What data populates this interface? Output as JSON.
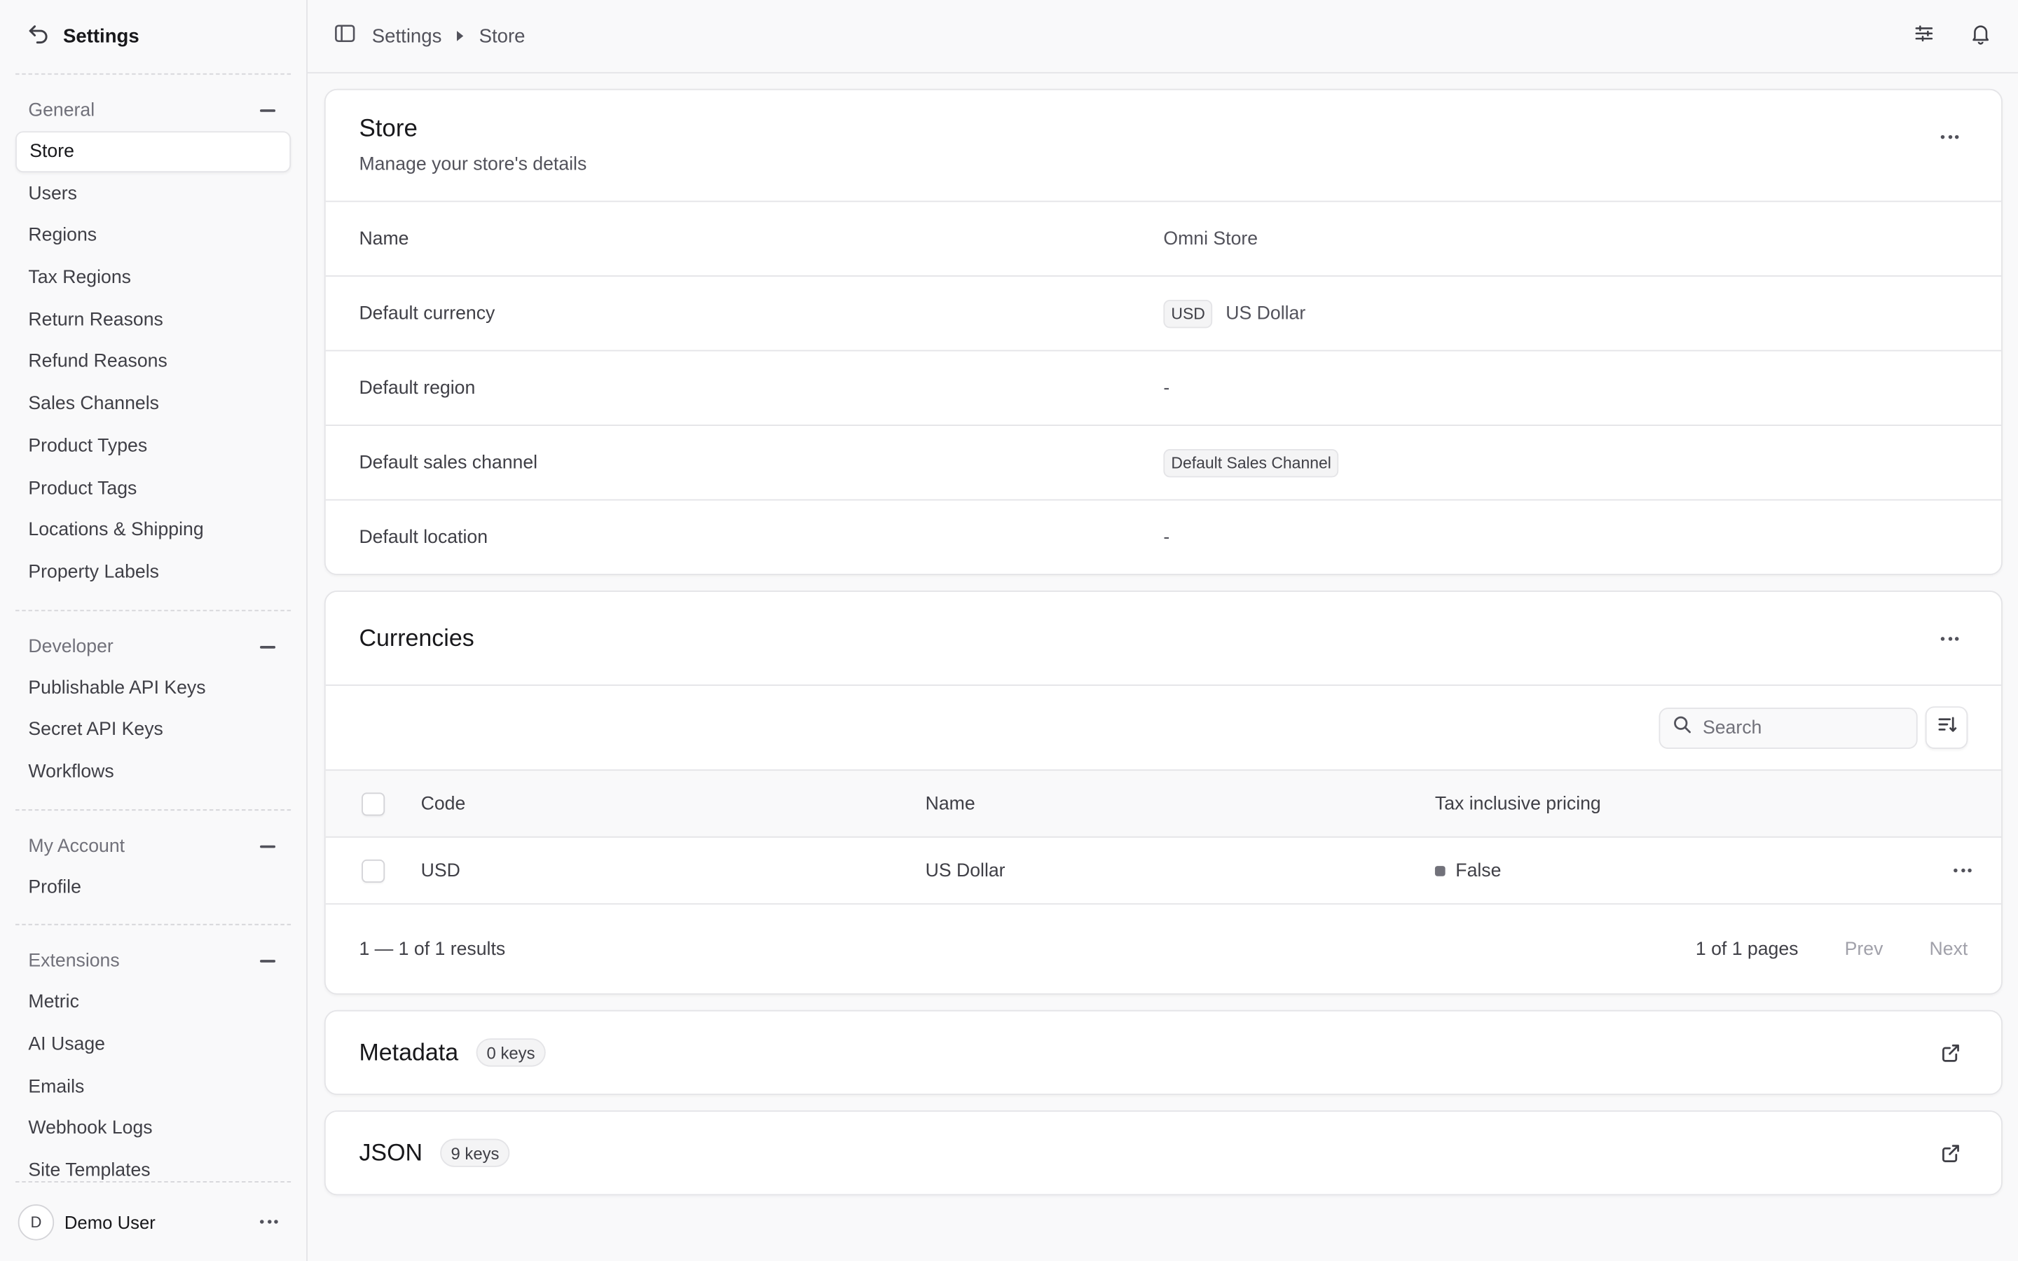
{
  "sidebar": {
    "title": "Settings",
    "sections": [
      {
        "label": "General",
        "items": [
          "Store",
          "Users",
          "Regions",
          "Tax Regions",
          "Return Reasons",
          "Refund Reasons",
          "Sales Channels",
          "Product Types",
          "Product Tags",
          "Locations & Shipping",
          "Property Labels"
        ]
      },
      {
        "label": "Developer",
        "items": [
          "Publishable API Keys",
          "Secret API Keys",
          "Workflows"
        ]
      },
      {
        "label": "My Account",
        "items": [
          "Profile"
        ]
      },
      {
        "label": "Extensions",
        "items": [
          "Metric",
          "AI Usage",
          "Emails",
          "Webhook Logs",
          "Site Templates"
        ]
      }
    ],
    "active_item": "Store",
    "user": {
      "initial": "D",
      "name": "Demo User"
    }
  },
  "breadcrumb": {
    "items": [
      "Settings",
      "Store"
    ]
  },
  "store": {
    "title": "Store",
    "subtitle": "Manage your store's details",
    "fields": {
      "name": {
        "label": "Name",
        "value": "Omni Store"
      },
      "currency": {
        "label": "Default currency",
        "code": "USD",
        "value": "US Dollar"
      },
      "region": {
        "label": "Default region",
        "value": "-"
      },
      "sales_channel": {
        "label": "Default sales channel",
        "value": "Default Sales Channel"
      },
      "location": {
        "label": "Default location",
        "value": "-"
      }
    }
  },
  "currencies": {
    "title": "Currencies",
    "search_placeholder": "Search",
    "columns": {
      "code": "Code",
      "name": "Name",
      "tax": "Tax inclusive pricing"
    },
    "rows": [
      {
        "code": "USD",
        "name": "US Dollar",
        "tax": "False"
      }
    ],
    "results_text": "1 — 1 of 1 results",
    "pages_text": "1 of 1 pages",
    "prev": "Prev",
    "next": "Next"
  },
  "metadata": {
    "title": "Metadata",
    "count": "0 keys"
  },
  "json": {
    "title": "JSON",
    "count": "9 keys"
  }
}
